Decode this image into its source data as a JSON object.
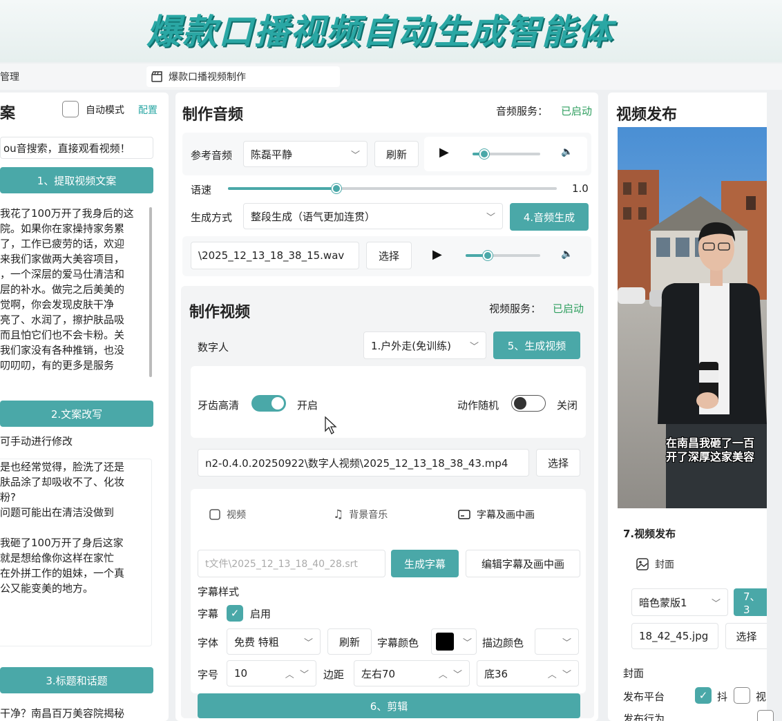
{
  "app": {
    "title": "爆款口播视频自动生成智能体",
    "tabs": [
      {
        "label": "管理"
      },
      {
        "label": "爆款口播视频制作"
      }
    ]
  },
  "left_panel": {
    "heading": "案",
    "auto_mode_label": "自动模式",
    "config_link": "配置",
    "search_text": "ou音搜索，直接观看视频！",
    "extract_button": "1、提取视频文案",
    "extracted_text": "我花了100万开了我身后的这\n院。如果你在家操持家务累\n了，工作已疲劳的话，欢迎\n来我们家做两大美容项目，\n，一个深层的爱马仕清洁和\n层的补水。做完之后美美的\n觉啊，你会发现皮肤干净\n亮了、水润了，擦护肤品吸\n而且怕它们也不会卡粉。关\n我们家没有各种推销，也没\n叨叨叨，有的更多是服务",
    "rewrite_button": "2.文案改写",
    "manual_edit_label": "可手动进行修改",
    "rewritten_text": "是也经常觉得，脸洗了还是\n肤品涂了却吸收不了、化妆\n粉?\n问题可能出在清洁没做到\n\n   我砸了100万开了身后这家\n就是想给像你这样在家忙\n在外拼工作的姐妹，一个真\n公又能变美的地方。",
    "title_button": "3.标题和话题",
    "title_text": "干净？南昌百万美容院揭秘"
  },
  "audio": {
    "heading": "制作音频",
    "service_label": "音频服务：",
    "service_status": "已启动",
    "ref_label": "参考音频",
    "ref_value": "陈磊平静",
    "refresh": "刷新",
    "speed_label": "语速",
    "speed_value": "1.0",
    "speed_fraction": 0.33,
    "ref_player_fraction": 0.17,
    "mode_label": "生成方式",
    "mode_value": "整段生成（语气更加连贯）",
    "generate_button": "4.音频生成",
    "file_value": "\\2025_12_13_18_38_15.wav",
    "choose": "选择",
    "file_player_fraction": 0.3
  },
  "video": {
    "heading": "制作视频",
    "service_label": "视频服务：",
    "service_status": "已启动",
    "avatar_label": "数字人",
    "avatar_value": "1.户外走(免训练)",
    "generate_button": "5、生成视频",
    "teeth_label": "牙齿高清",
    "teeth_state": "开启",
    "action_label": "动作随机",
    "action_state": "关闭",
    "file_value": "n2-0.4.0.20250922\\数字人视频\\2025_12_13_18_38_43.mp4",
    "choose": "选择",
    "subtabs": [
      {
        "label": "视频",
        "icon": "square-icon"
      },
      {
        "label": "背景音乐",
        "icon": "music-note-icon"
      },
      {
        "label": "字幕及画中画",
        "icon": "subtitle-icon"
      }
    ],
    "srt_value": "t文件\\2025_12_13_18_40_28.srt",
    "gen_subtitle": "生成字幕",
    "edit_subtitle": "编辑字幕及画中画",
    "subtitle_style_label": "字幕样式",
    "subtitle_label": "字幕",
    "enable_label": "启用",
    "font_label": "字体",
    "font_value": "免费 特粗",
    "refresh": "刷新",
    "color_label": "字幕颜色",
    "subtitle_color": "#000000",
    "stroke_label": "描边颜色",
    "size_label": "字号",
    "size_value": "10",
    "margin_label": "边距",
    "margin_lr": "左右70",
    "margin_bottom": "底36",
    "edit_button": "6、剪辑"
  },
  "publish": {
    "heading": "视频发布",
    "preview_caption_1": "在南昌我砸了一百",
    "preview_caption_2": "开了深厚这家美容",
    "section_label": "7.视频发布",
    "cover_tab": "封面",
    "template_value": "暗色蒙版1",
    "template_button": "7、3",
    "image_value": "18_42_45.jpg",
    "choose": "选择",
    "cover_label": "封面",
    "platform_label": "发布平台",
    "platform_1": "抖",
    "platform_2": "视",
    "action_label": "发布行为"
  },
  "colors": {
    "accent": "#4aa8a8",
    "status_green": "#2e9e5e",
    "banner_text": "#2aa7a4"
  }
}
